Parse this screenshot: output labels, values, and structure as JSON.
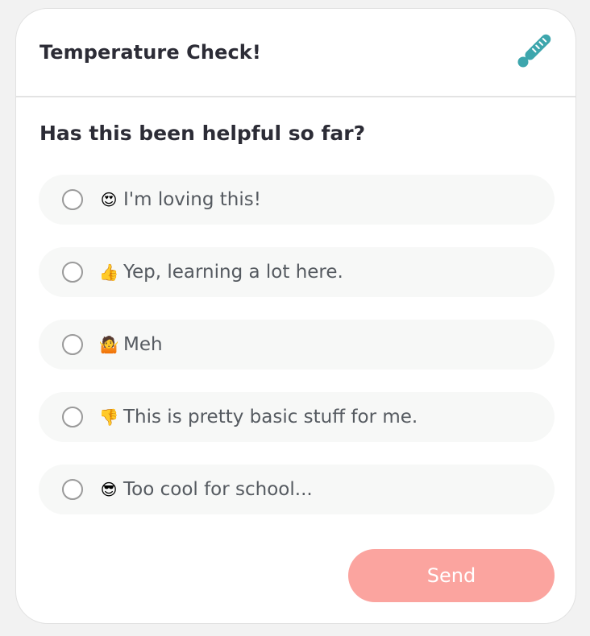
{
  "widget": {
    "title": "Temperature Check!",
    "icon": "thermometer-icon",
    "accent_color": "#3da6ad"
  },
  "question": "Has this been helpful so far?",
  "options": [
    {
      "emoji": "😍",
      "emoji_icon": "heart-eyes-emoji-icon",
      "label": "I'm loving this!"
    },
    {
      "emoji": "👍",
      "emoji_icon": "thumbs-up-emoji-icon",
      "label": "Yep, learning a lot here."
    },
    {
      "emoji": "🤷",
      "emoji_icon": "shrug-emoji-icon",
      "label": "Meh"
    },
    {
      "emoji": "👎",
      "emoji_icon": "thumbs-down-emoji-icon",
      "label": "This is pretty basic stuff for me."
    },
    {
      "emoji": "😎",
      "emoji_icon": "sunglasses-emoji-icon",
      "label": "Too cool for school..."
    }
  ],
  "send_button": {
    "label": "Send",
    "color": "#fba49f"
  }
}
